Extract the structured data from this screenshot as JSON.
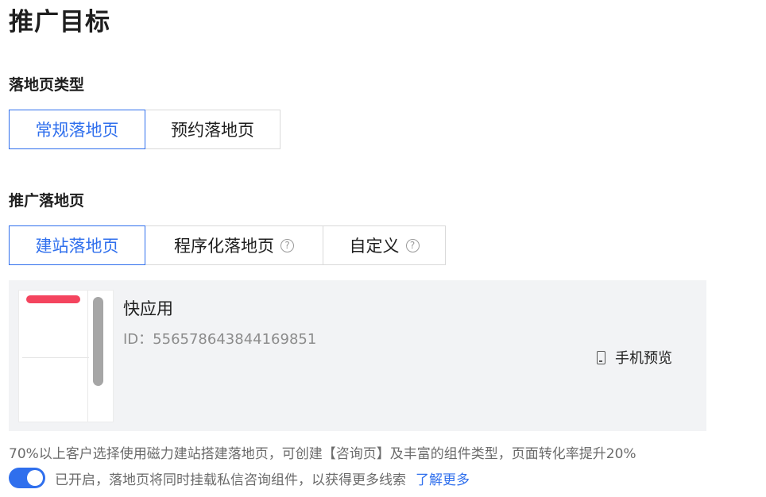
{
  "header": {
    "title": "推广目标"
  },
  "landing_type": {
    "label": "落地页类型",
    "options": [
      {
        "label": "常规落地页",
        "active": true
      },
      {
        "label": "预约落地页",
        "active": false
      }
    ]
  },
  "promo_page": {
    "label": "推广落地页",
    "options": [
      {
        "label": "建站落地页",
        "active": true,
        "help": false
      },
      {
        "label": "程序化落地页",
        "active": false,
        "help": true
      },
      {
        "label": "自定义",
        "active": false,
        "help": true
      }
    ]
  },
  "card": {
    "name": "快应用",
    "id_text": "ID：556578643844169851",
    "preview_label": "手机预览"
  },
  "note": "70%以上客户选择使用磁力建站搭建落地页，可创建【咨询页】及丰富的组件类型，页面转化率提升20%",
  "toggle": {
    "on": true,
    "text": "已开启，落地页将同时挂载私信咨询组件，以获得更多线索",
    "link": "了解更多"
  },
  "colors": {
    "accent": "#2f6fed",
    "border": "#d9d9d9",
    "card_bg": "#f2f3f5",
    "thumb_bar": "#f4445e"
  },
  "icons": {
    "help": "question-circle-icon",
    "phone": "mobile-phone-icon"
  }
}
